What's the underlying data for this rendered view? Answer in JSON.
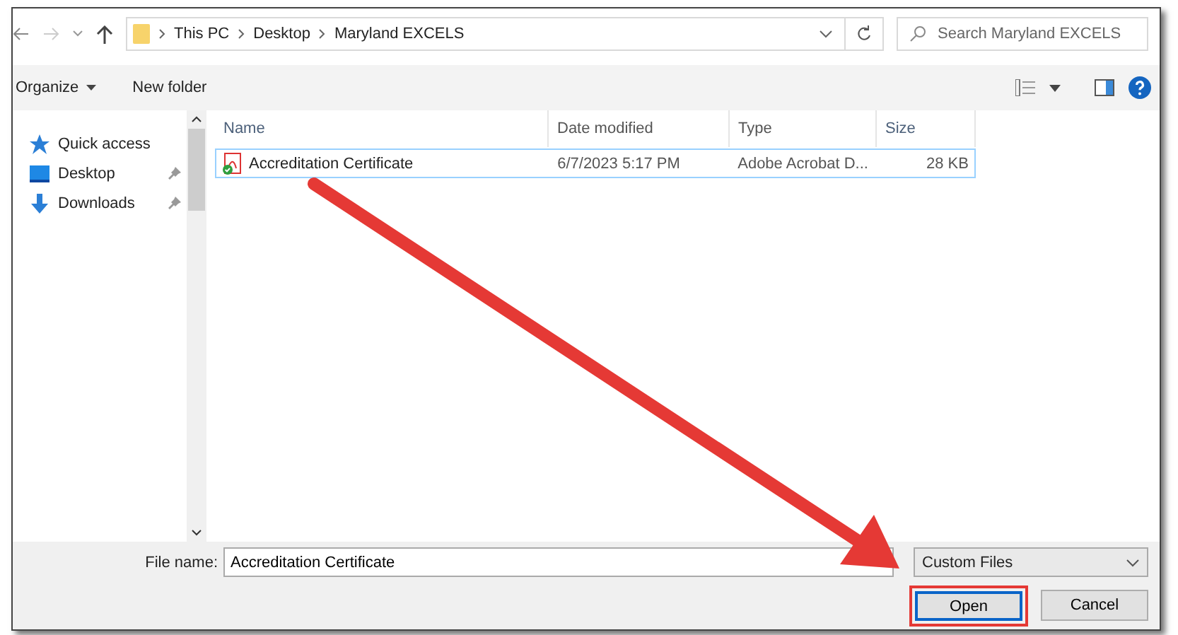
{
  "address": {
    "path": [
      "This PC",
      "Desktop",
      "Maryland EXCELS"
    ]
  },
  "search": {
    "placeholder": "Search Maryland EXCELS"
  },
  "commands": [
    "Organize",
    "New folder"
  ],
  "sidebar": {
    "items": [
      {
        "label": "Quick access",
        "kind": "star",
        "pinned": false
      },
      {
        "label": "Desktop",
        "kind": "desktop",
        "pinned": true
      },
      {
        "label": "Downloads",
        "kind": "download",
        "pinned": true
      }
    ]
  },
  "table": {
    "columns": [
      "Name",
      "Date modified",
      "Type",
      "Size"
    ],
    "rows": [
      {
        "name": "Accreditation Certificate",
        "date": "6/7/2023 5:17 PM",
        "type": "Adobe Acrobat D...",
        "size": "28 KB",
        "selected": true
      }
    ]
  },
  "file_name": {
    "label": "File name:",
    "value": "Accreditation Certificate"
  },
  "file_type": {
    "value": "Custom Files"
  },
  "buttons": [
    {
      "label": "Open",
      "highlighted": true
    },
    {
      "label": "Cancel",
      "highlighted": false
    }
  ]
}
